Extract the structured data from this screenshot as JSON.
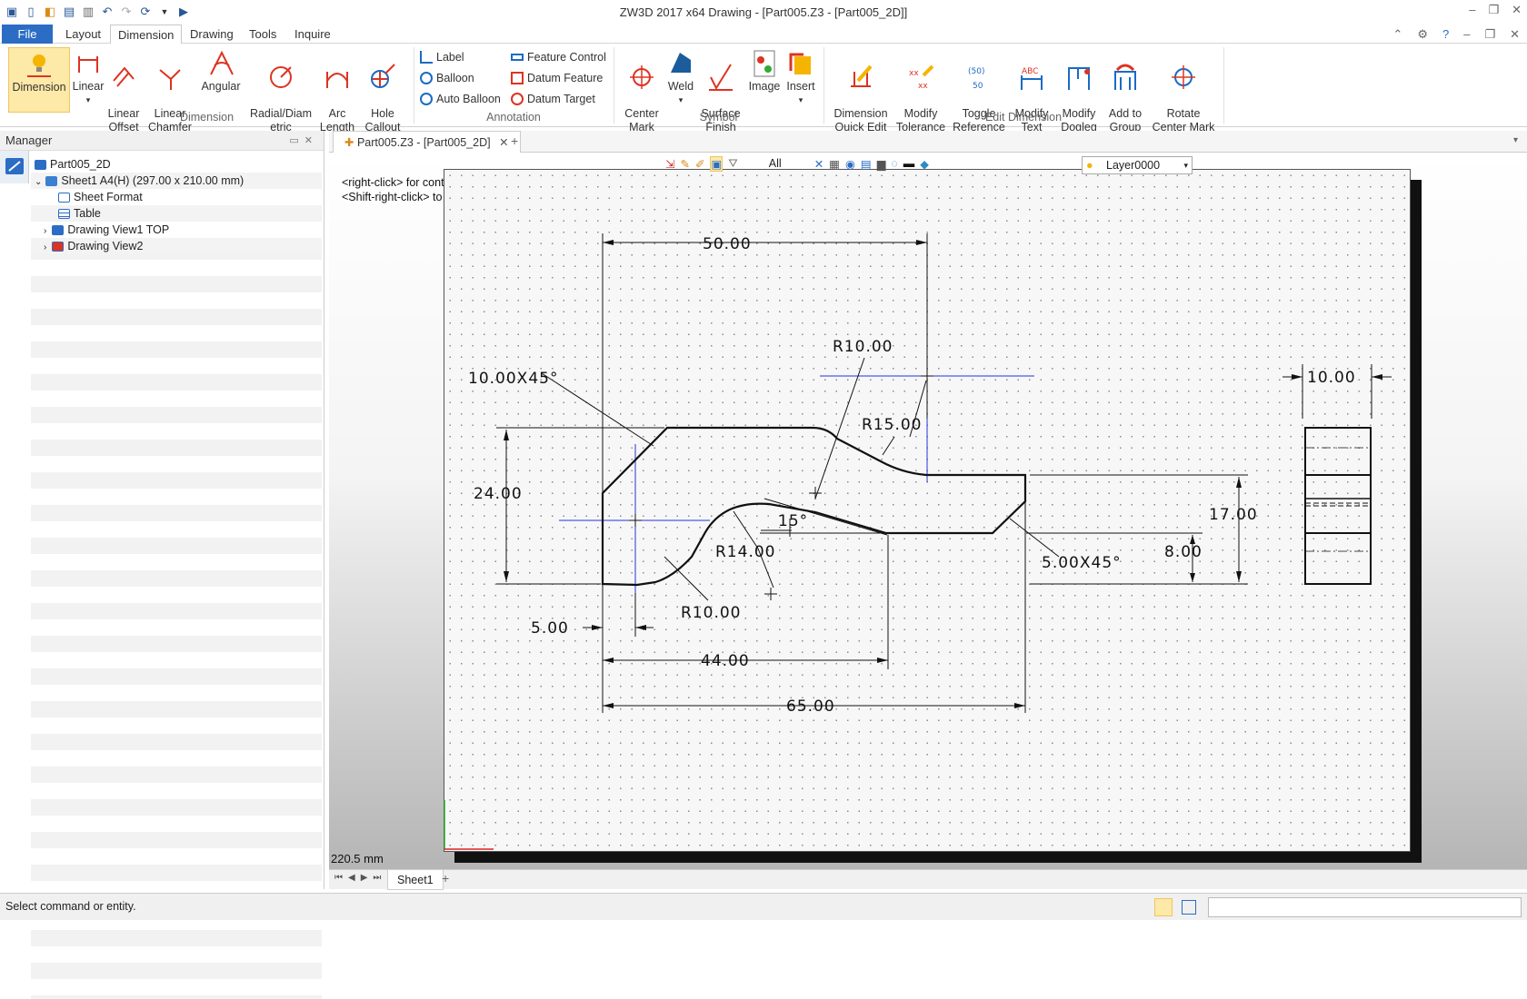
{
  "window": {
    "title": "ZW3D 2017  x64       Drawing - [Part005.Z3 - [Part005_2D]]"
  },
  "menu": {
    "file": "File",
    "tabs": [
      "Layout",
      "Dimension",
      "Drawing",
      "Tools",
      "Inquire"
    ]
  },
  "ribbon": {
    "dimension_group": {
      "name": "Dimension",
      "buttons": [
        "Dimension",
        "Linear",
        "Linear\nOffset",
        "Linear\nChamfer",
        "Angular",
        "Radial/Diam\netric",
        "Arc\nLength",
        "Hole\nCallout"
      ]
    },
    "annotation_group": {
      "name": "Annotation",
      "items": [
        "Label",
        "Balloon",
        "Auto Balloon",
        "Feature Control",
        "Datum Feature",
        "Datum Target"
      ]
    },
    "symbol_group": {
      "name": "Symbol",
      "buttons": [
        "Center\nMark",
        "Weld",
        "Surface\nFinish",
        "Image",
        "Insert"
      ]
    },
    "edit_group": {
      "name": "Edit Dimension",
      "buttons": [
        "Dimension\nQuick Edit",
        "Modify\nTolerance",
        "Toggle\nReference",
        "Modify\nText",
        "Modify\nDogleg",
        "Add to\nGroup",
        "Rotate\nCenter Mark"
      ]
    }
  },
  "manager": {
    "title": "Manager",
    "tree": [
      "Part005_2D",
      "Sheet1 A4(H) (297.00 x 210.00 mm)",
      "Sheet Format",
      "Table",
      "Drawing View1 TOP",
      "Drawing View2"
    ]
  },
  "doc_tab": "Part005.Z3 - [Part005_2D]",
  "canvas": {
    "hint1": "<right-click> for context-sensitive options.",
    "hint2": "<Shift-right-click> to display pick filter.",
    "filter": "All",
    "layer": "Layer0000",
    "measure": "220.5 mm"
  },
  "dims": [
    "50.00",
    "R10.00",
    "10.00X45°",
    "R15.00",
    "24.00",
    "15°",
    "R14.00",
    "17.00",
    "8.00",
    "5.00X45°",
    "R10.00",
    "5.00",
    "44.00",
    "65.00",
    "10.00"
  ],
  "sheet_tab": "Sheet1",
  "status": "Select command or entity."
}
